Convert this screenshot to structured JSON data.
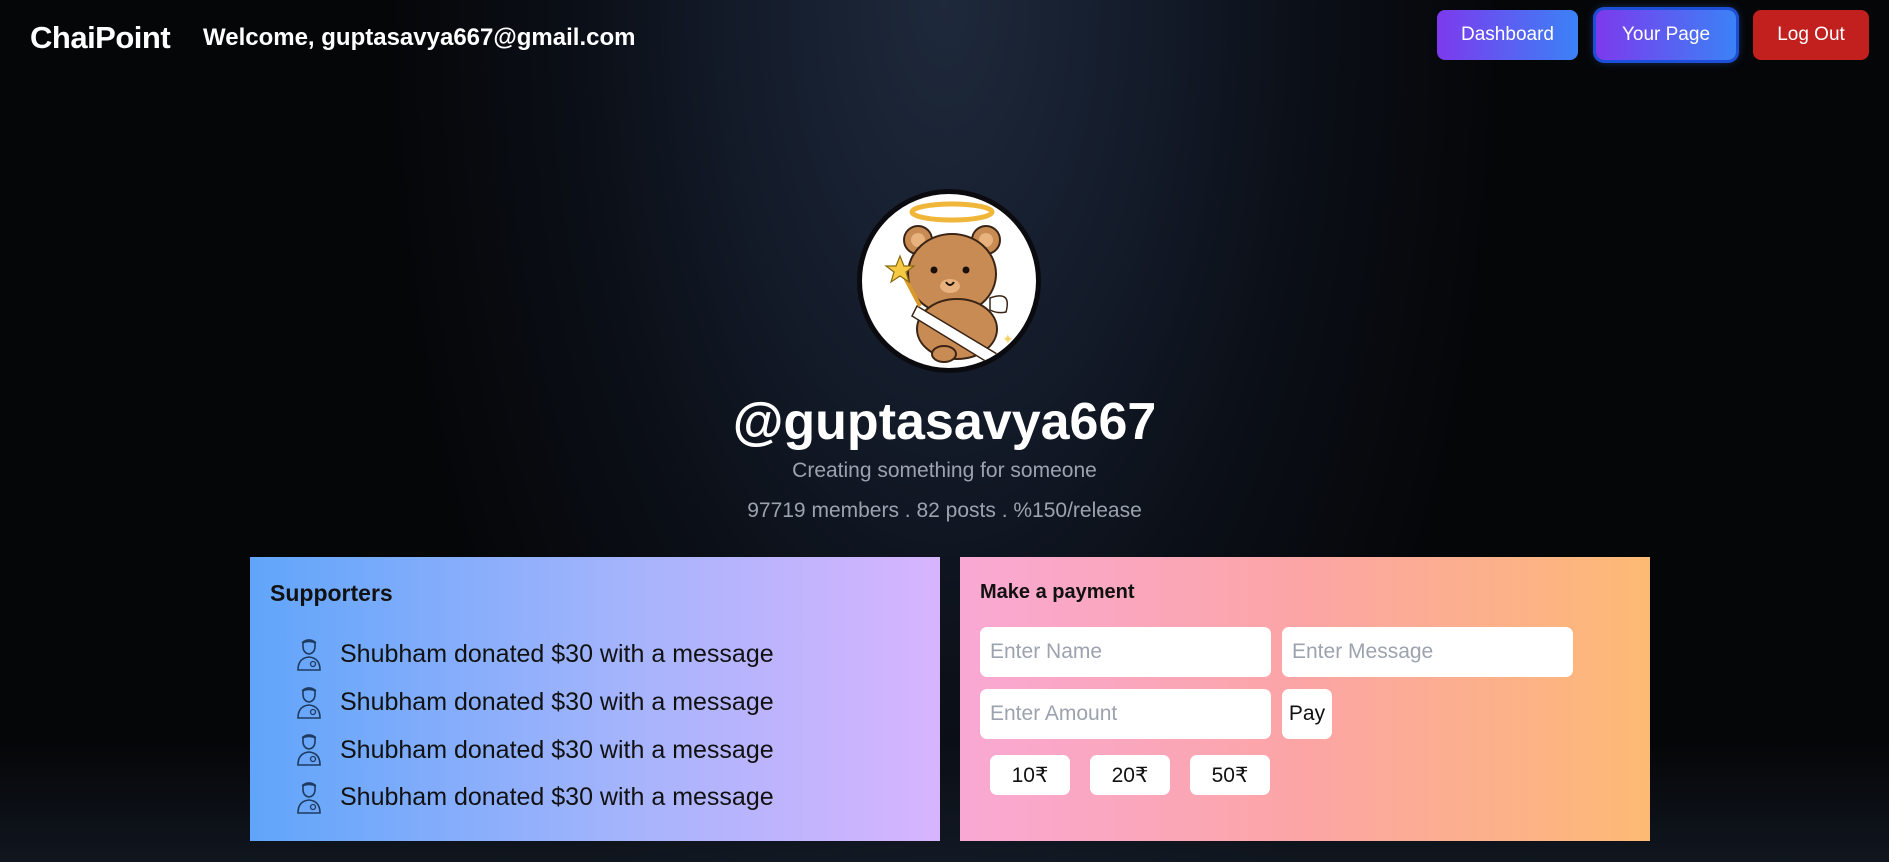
{
  "navbar": {
    "brand": "ChaiPoint",
    "welcome": "Welcome, guptasavya667@gmail.com",
    "buttons": {
      "dashboard": "Dashboard",
      "your_page": "Your Page",
      "log_out": "Log Out"
    }
  },
  "profile": {
    "avatar_icon": "angel-bear-avatar",
    "username": "@guptasavya667",
    "tagline": "Creating something for someone",
    "stats": "97719 members . 82 posts . %150/release"
  },
  "supporters": {
    "title": "Supporters",
    "items": [
      {
        "icon": "user-icon",
        "text": "Shubham donated $30 with a message"
      },
      {
        "icon": "user-icon",
        "text": "Shubham donated $30 with a message"
      },
      {
        "icon": "user-icon",
        "text": "Shubham donated $30 with a message"
      },
      {
        "icon": "user-icon",
        "text": "Shubham donated $30 with a message"
      }
    ]
  },
  "payment": {
    "title": "Make a payment",
    "name_placeholder": "Enter Name",
    "message_placeholder": "Enter Message",
    "amount_placeholder": "Enter Amount",
    "pay_label": "Pay",
    "chips": [
      "10₹",
      "20₹",
      "50₹"
    ]
  },
  "colors": {
    "nav_gradient_start": "#7c3aed",
    "nav_gradient_end": "#3b82f6",
    "logout": "#c21f1f",
    "supporters_gradient": [
      "#60a5fa",
      "#d8b4fe"
    ],
    "payment_gradient": [
      "#f9a8d4",
      "#fdba74"
    ]
  }
}
